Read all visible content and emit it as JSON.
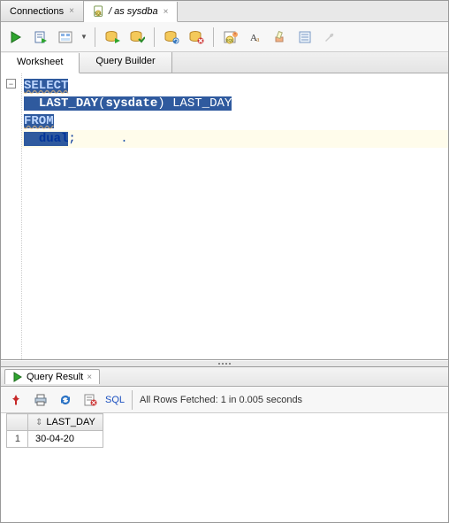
{
  "top_tabs": {
    "connections": "Connections",
    "active_label": "/ as sysdba"
  },
  "sub_tabs": {
    "worksheet": "Worksheet",
    "query_builder": "Query Builder"
  },
  "editor": {
    "line1_kw": "SELECT",
    "line2_indent": "  ",
    "line2_fn": "LAST_DAY",
    "line2_paren_open": "(",
    "line2_arg": "sysdate",
    "line2_paren_close": ")",
    "line2_space": " ",
    "line2_alias": "LAST_DAY",
    "line3_kw": "FROM",
    "line4_indent": "  ",
    "line4_txt": "dual",
    "line4_semi": ";"
  },
  "result": {
    "tab_label": "Query Result",
    "sql_link": "SQL",
    "status": "All Rows Fetched: 1 in 0.005 seconds",
    "col1": "LAST_DAY",
    "rows": [
      {
        "n": "1",
        "c1": "30-04-20"
      }
    ]
  }
}
